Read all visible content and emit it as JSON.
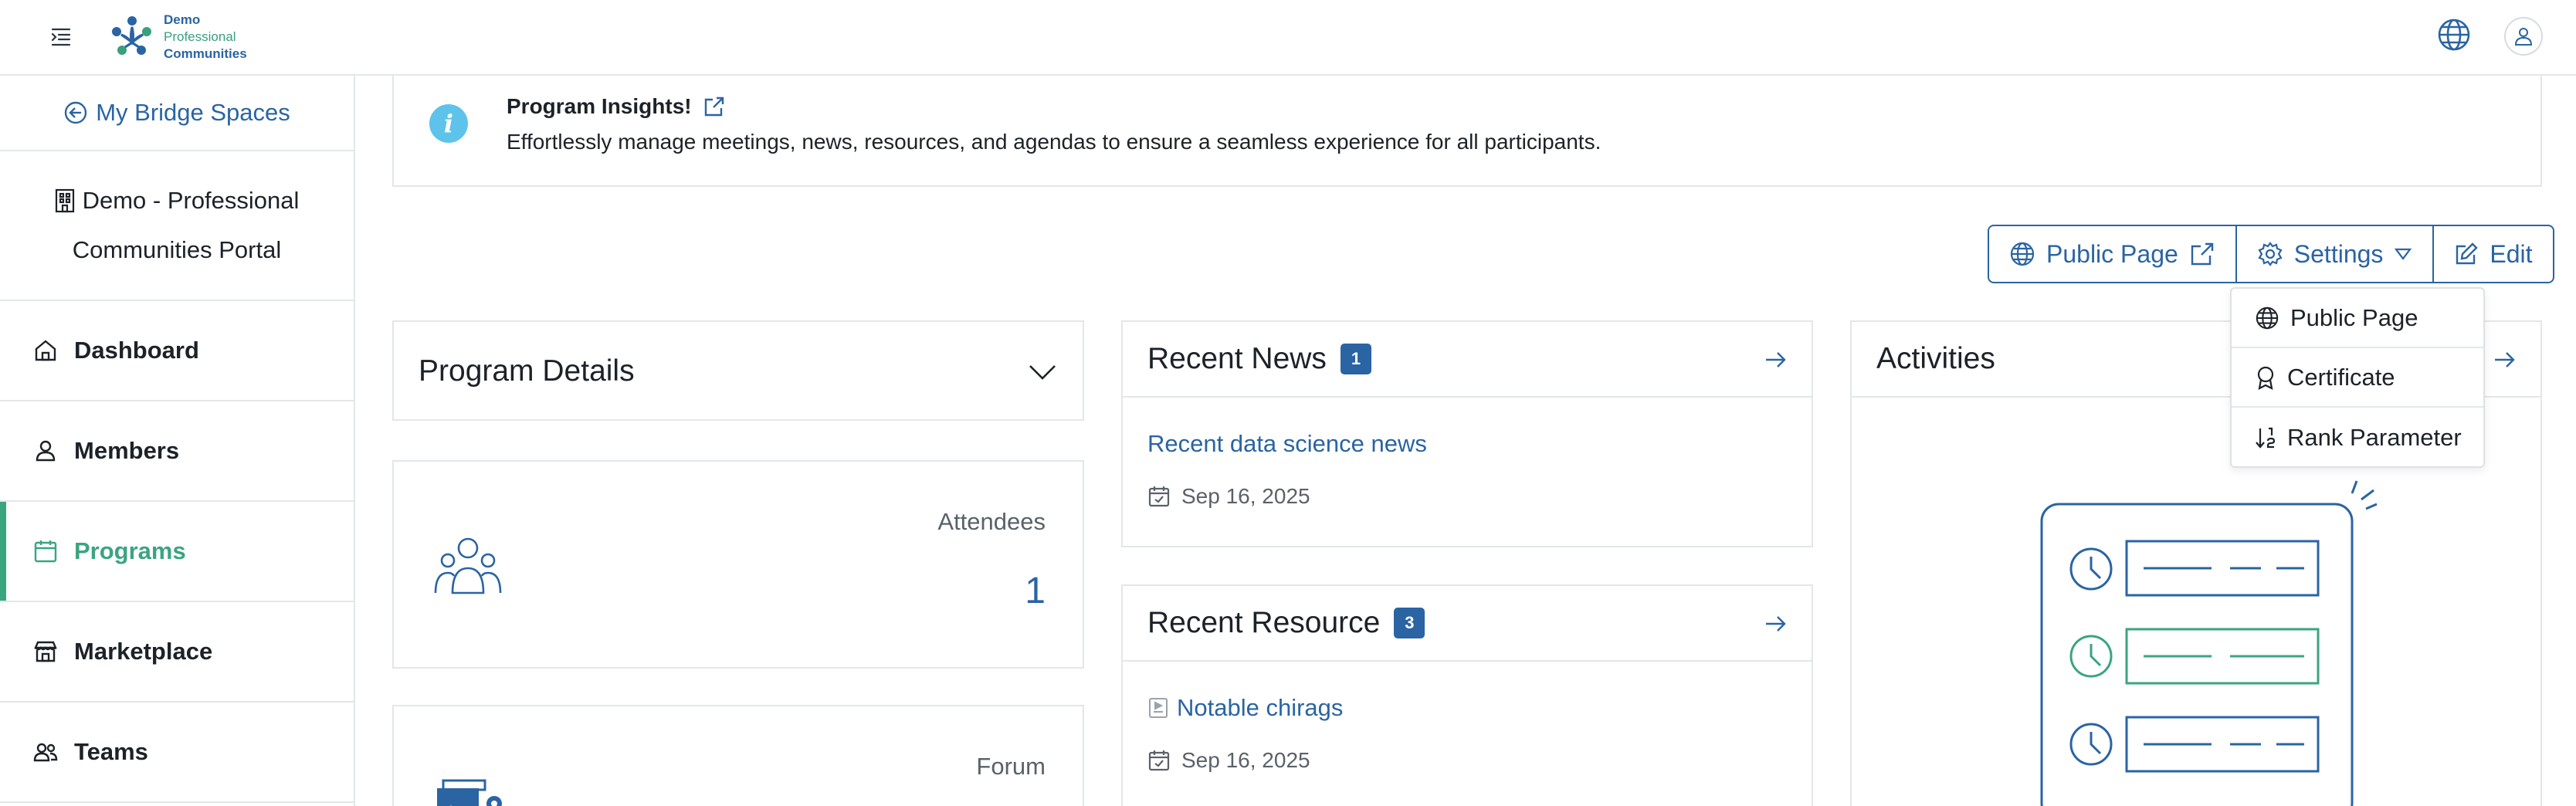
{
  "logo": {
    "line1": "Demo",
    "line2": "Professional",
    "line3": "Communities"
  },
  "sidebar": {
    "back_label": "My Bridge Spaces",
    "portal_line1": "Demo - Professional",
    "portal_line2": "Communities Portal",
    "items": [
      {
        "label": "Dashboard",
        "icon": "home-icon"
      },
      {
        "label": "Members",
        "icon": "person-icon"
      },
      {
        "label": "Programs",
        "icon": "calendar-icon",
        "active": true
      },
      {
        "label": "Marketplace",
        "icon": "store-icon"
      },
      {
        "label": "Teams",
        "icon": "people-icon"
      }
    ]
  },
  "banner": {
    "title": "Program Insights!",
    "description": "Effortlessly manage meetings, news, resources, and agendas to ensure a seamless experience for all participants."
  },
  "actions": {
    "public_page": "Public Page",
    "settings": "Settings",
    "edit": "Edit"
  },
  "settings_menu": {
    "items": [
      "Public Page",
      "Certificate",
      "Rank Parameter"
    ]
  },
  "program_details": {
    "title": "Program Details"
  },
  "attendees": {
    "label": "Attendees",
    "value": "1"
  },
  "forum": {
    "label": "Forum"
  },
  "news": {
    "title": "Recent News",
    "count": "1",
    "item_title": "Recent data science news",
    "item_date": "Sep 16, 2025"
  },
  "resources": {
    "title": "Recent Resource",
    "count": "3",
    "item_title": "Notable chirags",
    "item_date": "Sep 16, 2025"
  },
  "activities": {
    "title": "Activities"
  },
  "colors": {
    "primary": "#2a64a3",
    "accent": "#3aa57f",
    "info": "#5ec3ea"
  }
}
